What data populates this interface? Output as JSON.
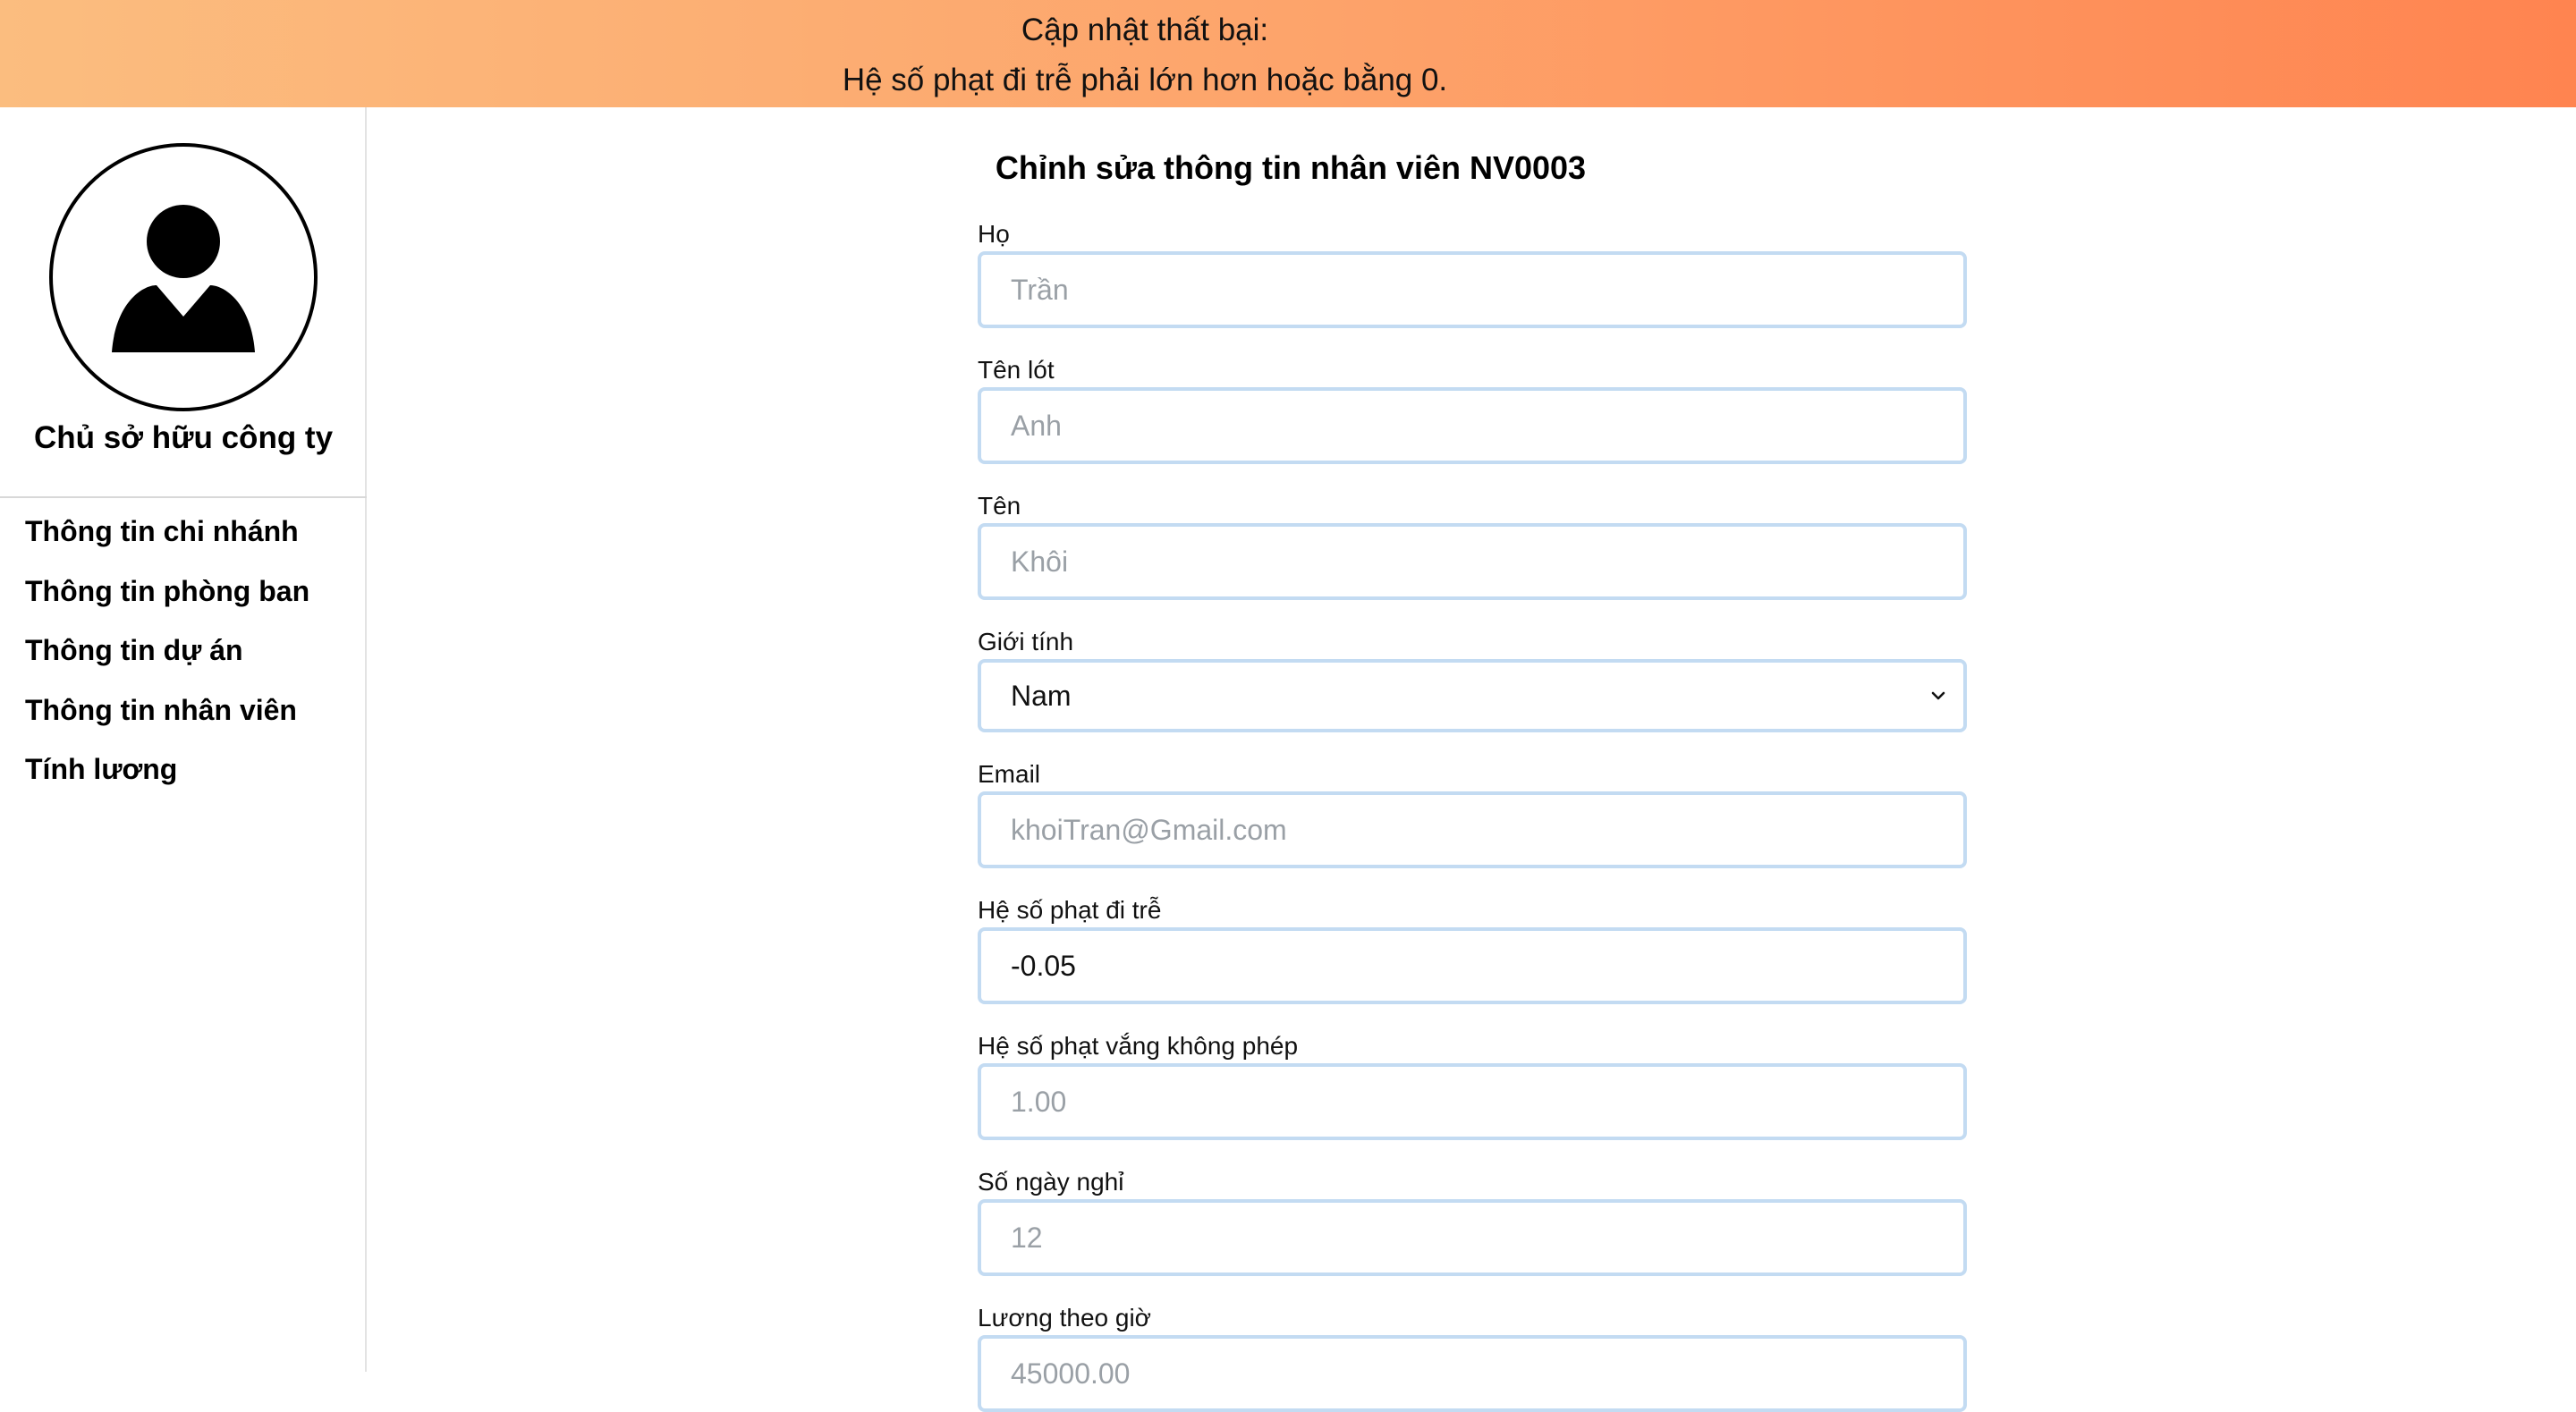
{
  "banner": {
    "title": "Cập nhật thất bại:",
    "message": "Hệ số phạt đi trễ phải lớn hơn hoặc bằng 0."
  },
  "sidebar": {
    "role": "Chủ sở hữu công ty",
    "items": [
      {
        "label": "Thông tin chi nhánh"
      },
      {
        "label": "Thông tin phòng ban"
      },
      {
        "label": "Thông tin dự án"
      },
      {
        "label": "Thông tin nhân viên"
      },
      {
        "label": "Tính lương"
      }
    ]
  },
  "form": {
    "title": "Chỉnh sửa thông tin nhân viên NV0003",
    "fields": [
      {
        "label": "Họ",
        "placeholder": "Trần",
        "value": ""
      },
      {
        "label": "Tên lót",
        "placeholder": "Anh",
        "value": ""
      },
      {
        "label": "Tên",
        "placeholder": "Khôi",
        "value": ""
      },
      {
        "label": "Giới tính",
        "value": "Nam"
      },
      {
        "label": "Email",
        "placeholder": "khoiTran@Gmail.com",
        "value": ""
      },
      {
        "label": "Hệ số phạt đi trễ",
        "placeholder": "",
        "value": "-0.05"
      },
      {
        "label": "Hệ số phạt vắng không phép",
        "placeholder": "1.00",
        "value": ""
      },
      {
        "label": "Số ngày nghỉ",
        "placeholder": "12",
        "value": ""
      },
      {
        "label": "Lương theo giờ",
        "placeholder": "45000.00",
        "value": ""
      }
    ]
  },
  "colors": {
    "banner_start": "#fbbd7f",
    "banner_end": "#ff8450",
    "input_border": "#c3dbf2",
    "placeholder": "#9aa0a6"
  },
  "icons": {
    "avatar": "user-silhouette-icon",
    "select_arrow": "chevron-down-icon"
  }
}
